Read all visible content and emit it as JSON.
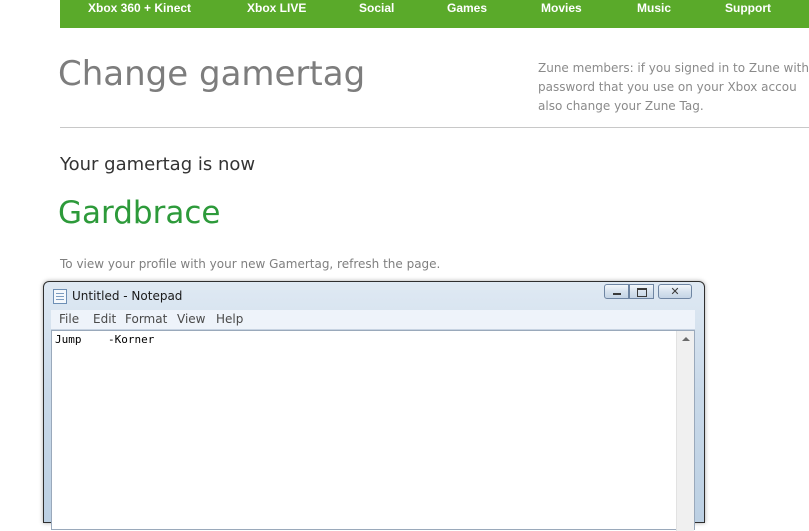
{
  "nav": {
    "items": [
      "Xbox 360 + Kinect",
      "Xbox LIVE",
      "Social",
      "Games",
      "Movies",
      "Music",
      "Support"
    ],
    "color": "#5aaa2a"
  },
  "page": {
    "title": "Change gamertag",
    "zune_lines": [
      "Zune members: if you signed in to Zune with",
      "password that you use on your Xbox accou",
      "also change your Zune Tag."
    ],
    "now_label": "Your gamertag is now",
    "gamertag": "Gardbrace",
    "gamertag_color": "#2d9a3a",
    "refresh_note": "To view your profile with your new Gamertag, refresh the page."
  },
  "notepad": {
    "title": "Untitled - Notepad",
    "icon": "notepad-icon",
    "menu": [
      "File",
      "Edit",
      "Format",
      "View",
      "Help"
    ],
    "content": "Jump    -Korner"
  }
}
